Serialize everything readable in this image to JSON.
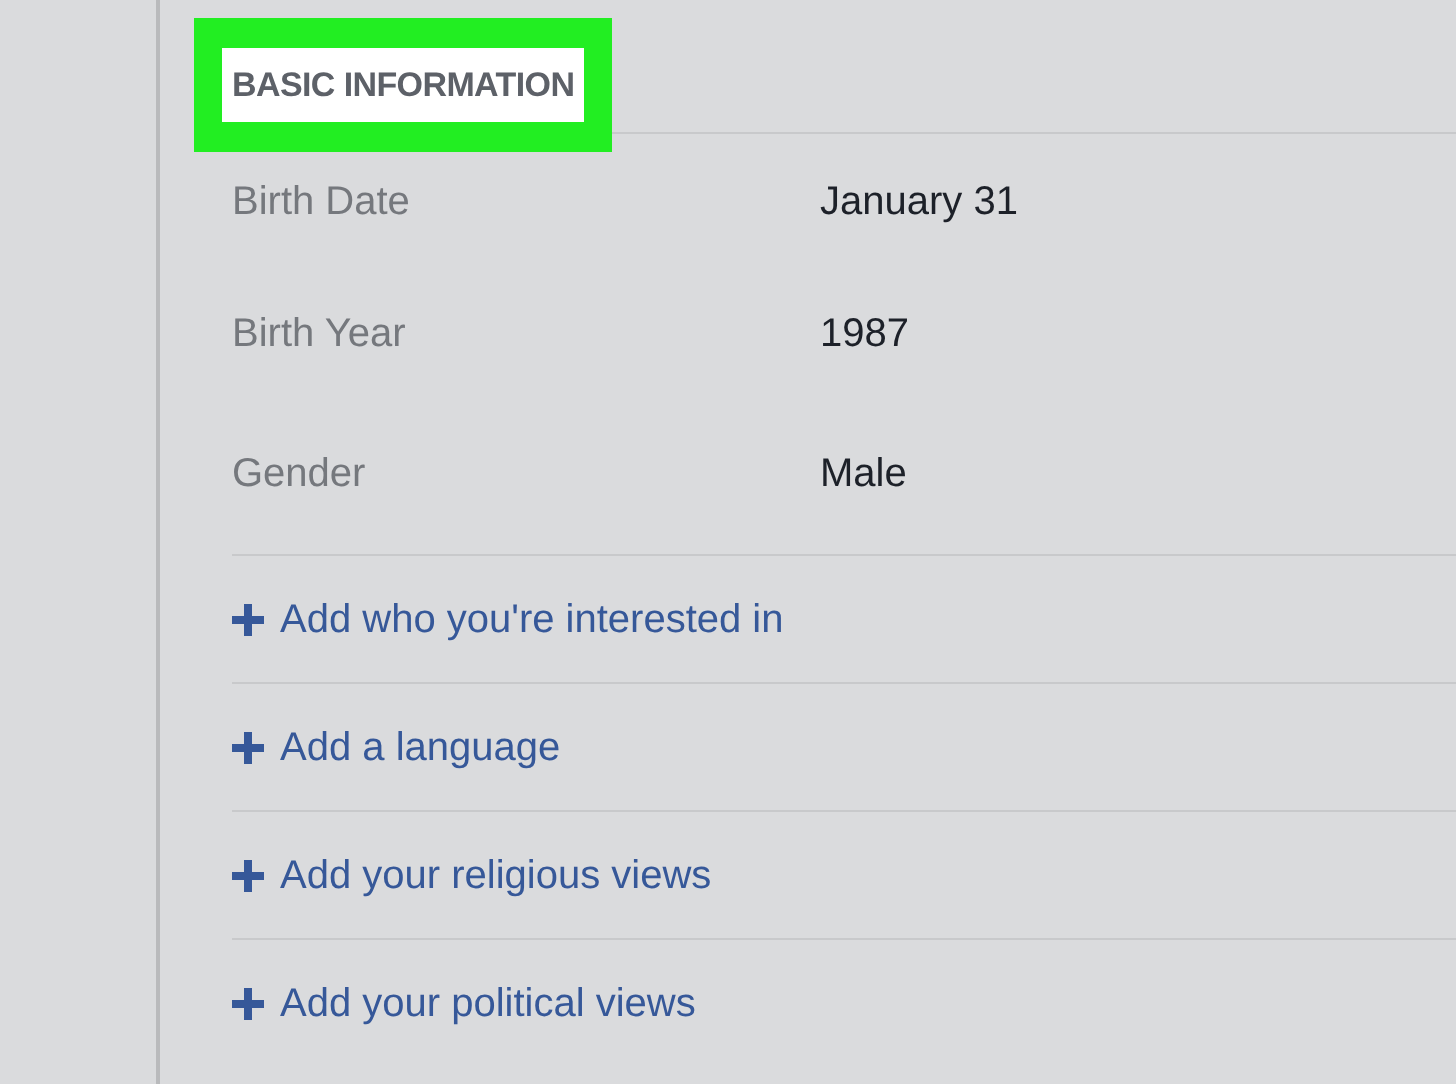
{
  "section": {
    "title": "BASIC INFORMATION",
    "highlighted": true
  },
  "fields": [
    {
      "label": "Birth Date",
      "value": "January 31"
    },
    {
      "label": "Birth Year",
      "value": "1987"
    },
    {
      "label": "Gender",
      "value": "Male"
    }
  ],
  "add_links": [
    {
      "label": "Add who you're interested in"
    },
    {
      "label": "Add a language"
    },
    {
      "label": "Add your religious views"
    },
    {
      "label": "Add your political views"
    }
  ]
}
